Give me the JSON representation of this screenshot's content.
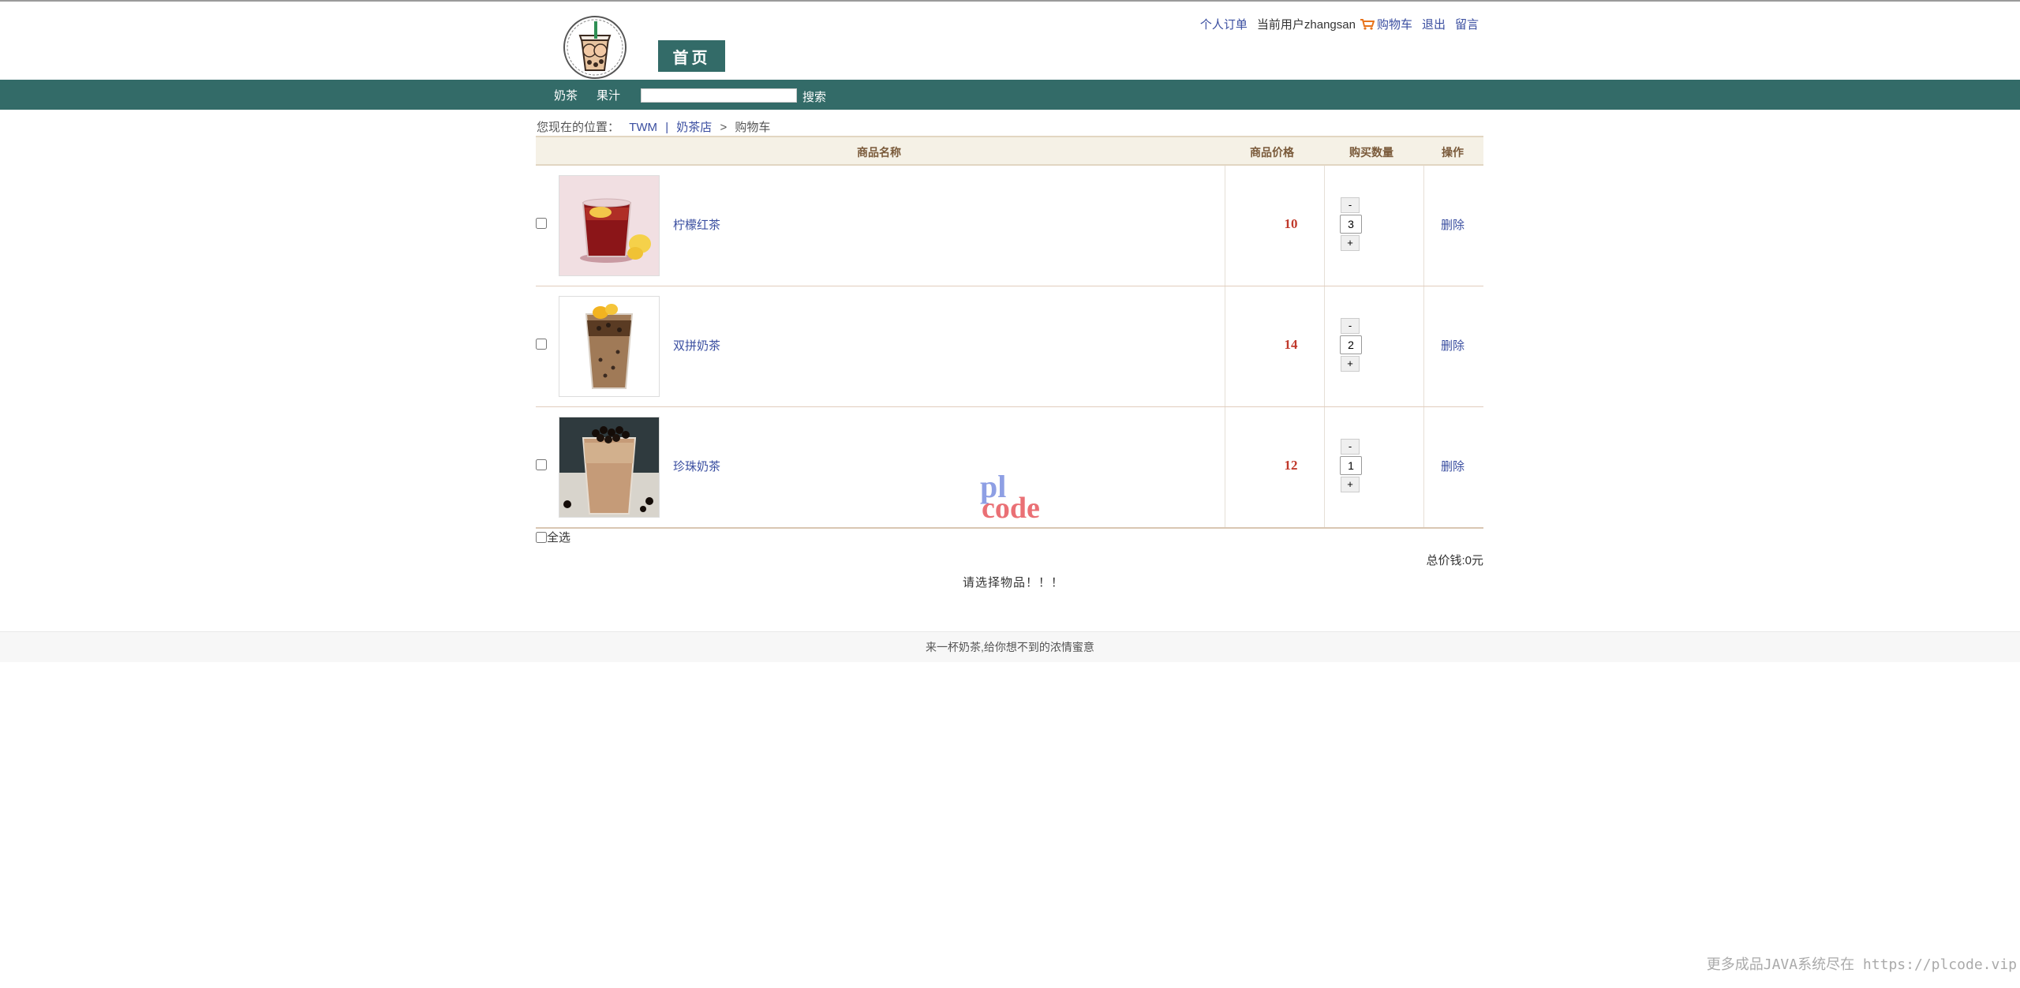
{
  "header": {
    "home_tab": "首页",
    "links": {
      "my_orders": "个人订单",
      "current_user": "当前用户zhangsan",
      "cart": "购物车",
      "logout": "退出",
      "message": "留言"
    }
  },
  "nav": {
    "items": [
      "奶茶",
      "果汁"
    ],
    "search_value": "",
    "search_label": "搜索"
  },
  "breadcrumb": {
    "prefix": "您现在的位置：",
    "link_1": "TWM",
    "separator_1": "|",
    "link_2": "奶茶店",
    "separator_2": ">",
    "current": "购物车"
  },
  "cart": {
    "columns": {
      "name": "商品名称",
      "price": "商品价格",
      "quantity": "购买数量",
      "action": "操作"
    },
    "items": [
      {
        "name": "柠檬红茶",
        "price": "10",
        "quantity": "3",
        "checked": false,
        "image": "lemon-black-tea-photo"
      },
      {
        "name": "双拼奶茶",
        "price": "14",
        "quantity": "2",
        "checked": false,
        "image": "double-milk-tea-photo"
      },
      {
        "name": "珍珠奶茶",
        "price": "12",
        "quantity": "1",
        "checked": false,
        "image": "pearl-milk-tea-photo"
      }
    ],
    "minus_label": "-",
    "plus_label": "+",
    "delete_label": "删除",
    "select_all_label": "全选",
    "total_label": "总价钱:0元",
    "hint": "请选择物品！！！"
  },
  "watermark_text": [
    "pl",
    "code"
  ],
  "footer": {
    "text": "来一杯奶茶,给你想不到的浓情蜜意"
  },
  "corner_text": "更多成品JAVA系统尽在 https://plcode.vip",
  "colors": {
    "brand": "#336b68",
    "link": "#3a4ea0",
    "price": "#c0392b",
    "table_header_bg": "#f5f1e6"
  }
}
